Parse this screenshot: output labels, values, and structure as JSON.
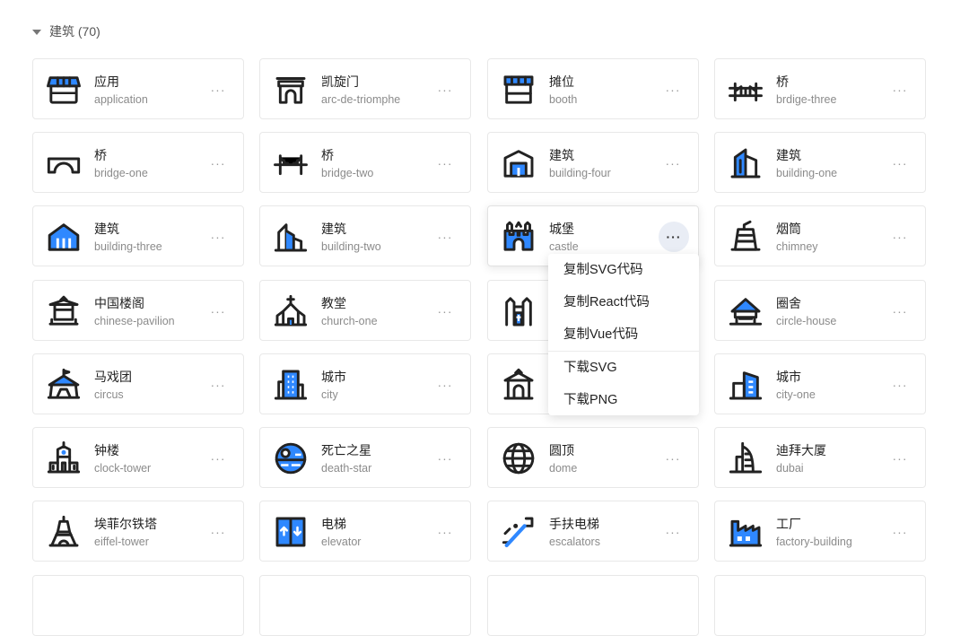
{
  "section": {
    "title": "建筑 (70)"
  },
  "more_label": "···",
  "colors": {
    "blue": "#2F88FF",
    "ink": "#222222"
  },
  "cards": [
    {
      "zh": "应用",
      "en": "application",
      "icon": "shop-icon"
    },
    {
      "zh": "凯旋门",
      "en": "arc-de-triomphe",
      "icon": "arch-icon"
    },
    {
      "zh": "摊位",
      "en": "booth",
      "icon": "booth-icon"
    },
    {
      "zh": "桥",
      "en": "brdige-three",
      "icon": "bridge-three-icon"
    },
    {
      "zh": "桥",
      "en": "bridge-one",
      "icon": "bridge-one-icon"
    },
    {
      "zh": "桥",
      "en": "bridge-two",
      "icon": "bridge-two-icon"
    },
    {
      "zh": "建筑",
      "en": "building-four",
      "icon": "building-four-icon"
    },
    {
      "zh": "建筑",
      "en": "building-one",
      "icon": "building-one-icon"
    },
    {
      "zh": "建筑",
      "en": "building-three",
      "icon": "building-three-icon"
    },
    {
      "zh": "建筑",
      "en": "building-two",
      "icon": "building-two-icon"
    },
    {
      "zh": "城堡",
      "en": "castle",
      "icon": "castle-icon"
    },
    {
      "zh": "烟筒",
      "en": "chimney",
      "icon": "chimney-icon"
    },
    {
      "zh": "中国楼阁",
      "en": "chinese-pavilion",
      "icon": "pavilion-icon"
    },
    {
      "zh": "教堂",
      "en": "church-one",
      "icon": "church-icon"
    },
    {
      "zh": "",
      "en": "",
      "icon": "church-two-icon"
    },
    {
      "zh": "圈舍",
      "en": "circle-house",
      "icon": "circle-house-icon"
    },
    {
      "zh": "马戏团",
      "en": "circus",
      "icon": "circus-icon"
    },
    {
      "zh": "城市",
      "en": "city",
      "icon": "city-icon"
    },
    {
      "zh": "",
      "en": "",
      "icon": "gate-icon"
    },
    {
      "zh": "城市",
      "en": "city-one",
      "icon": "city-one-icon"
    },
    {
      "zh": "钟楼",
      "en": "clock-tower",
      "icon": "clock-tower-icon"
    },
    {
      "zh": "死亡之星",
      "en": "death-star",
      "icon": "death-star-icon"
    },
    {
      "zh": "圆顶",
      "en": "dome",
      "icon": "dome-icon"
    },
    {
      "zh": "迪拜大厦",
      "en": "dubai",
      "icon": "dubai-icon"
    },
    {
      "zh": "埃菲尔铁塔",
      "en": "eiffel-tower",
      "icon": "eiffel-tower-icon"
    },
    {
      "zh": "电梯",
      "en": "elevator",
      "icon": "elevator-icon"
    },
    {
      "zh": "手扶电梯",
      "en": "escalators",
      "icon": "escalators-icon"
    },
    {
      "zh": "工厂",
      "en": "factory-building",
      "icon": "factory-icon"
    }
  ],
  "context_menu": {
    "items": [
      "复制SVG代码",
      "复制React代码",
      "复制Vue代码",
      "下载SVG",
      "下载PNG"
    ]
  }
}
